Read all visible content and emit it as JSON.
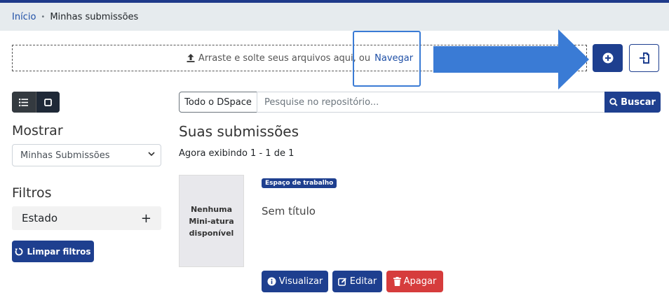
{
  "breadcrumb": {
    "home": "Início",
    "separator": "•",
    "current": "Minhas submissões"
  },
  "upload": {
    "text": "Arraste e solte seus arquivos aqui, ou",
    "browse": "Navegar"
  },
  "view_toggle": {
    "list_icon": "list-icon",
    "grid_icon": "square-icon"
  },
  "sidebar": {
    "show_heading": "Mostrar",
    "show_selected": "Minhas Submissões",
    "filters_heading": "Filtros",
    "filter_state": "Estado",
    "filter_toggle": "+",
    "clear_filters": "Limpar filtros"
  },
  "search": {
    "scope": "Todo o DSpace",
    "placeholder": "Pesquise no repositório...",
    "button": "Buscar"
  },
  "main": {
    "title": "Suas submissões",
    "showing": "Agora exibindo 1 - 1 de 1",
    "item": {
      "thumbnail_text": "Nenhuma Mini-atura disponível",
      "badge": "Espaço de trabalho",
      "title": "Sem título"
    },
    "actions": {
      "view": "Visualizar",
      "edit": "Editar",
      "delete": "Apagar"
    }
  },
  "colors": {
    "primary": "#1e3f8f",
    "danger": "#d63c3c",
    "arrow": "#3a7bd5"
  }
}
